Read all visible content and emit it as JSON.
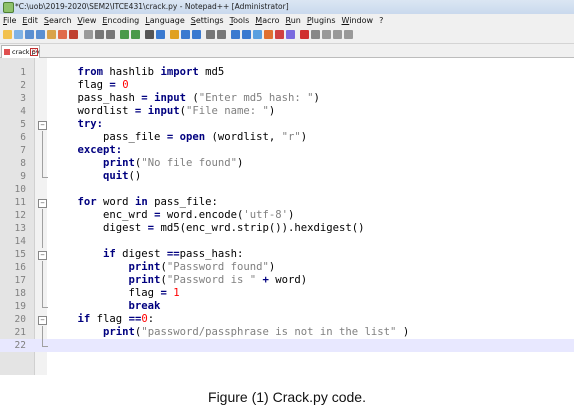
{
  "window": {
    "title": "*C:\\uob\\2019-2020\\SEM2\\ITCE431\\crack.py - Notepad++ [Administrator]"
  },
  "menu": [
    "File",
    "Edit",
    "Search",
    "View",
    "Encoding",
    "Language",
    "Settings",
    "Tools",
    "Macro",
    "Run",
    "Plugins",
    "Window",
    "?"
  ],
  "tab": {
    "label": "crack.py"
  },
  "code_lines": [
    [
      {
        "t": "    "
      },
      {
        "t": "from",
        "c": "kw"
      },
      {
        "t": " hashlib "
      },
      {
        "t": "import",
        "c": "kw"
      },
      {
        "t": " md5"
      }
    ],
    [
      {
        "t": "    flag "
      },
      {
        "t": "=",
        "c": "op"
      },
      {
        "t": " "
      },
      {
        "t": "0",
        "c": "num"
      }
    ],
    [
      {
        "t": "    pass_hash "
      },
      {
        "t": "=",
        "c": "op"
      },
      {
        "t": " "
      },
      {
        "t": "input",
        "c": "kw"
      },
      {
        "t": " ("
      },
      {
        "t": "\"Enter md5 hash: \"",
        "c": "str"
      },
      {
        "t": ")"
      }
    ],
    [
      {
        "t": "    wordlist "
      },
      {
        "t": "=",
        "c": "op"
      },
      {
        "t": " "
      },
      {
        "t": "input",
        "c": "kw"
      },
      {
        "t": "("
      },
      {
        "t": "\"File name: \"",
        "c": "str"
      },
      {
        "t": ")"
      }
    ],
    [
      {
        "t": "    "
      },
      {
        "t": "try:",
        "c": "kw"
      }
    ],
    [
      {
        "t": "        pass_file "
      },
      {
        "t": "=",
        "c": "op"
      },
      {
        "t": " "
      },
      {
        "t": "open",
        "c": "kw"
      },
      {
        "t": " (wordlist, "
      },
      {
        "t": "\"r\"",
        "c": "str"
      },
      {
        "t": ")"
      }
    ],
    [
      {
        "t": "    "
      },
      {
        "t": "except:",
        "c": "kw"
      }
    ],
    [
      {
        "t": "        "
      },
      {
        "t": "print",
        "c": "kw"
      },
      {
        "t": "("
      },
      {
        "t": "\"No file found\"",
        "c": "str"
      },
      {
        "t": ")"
      }
    ],
    [
      {
        "t": "        "
      },
      {
        "t": "quit",
        "c": "kw"
      },
      {
        "t": "()"
      }
    ],
    [],
    [
      {
        "t": "    "
      },
      {
        "t": "for",
        "c": "kw"
      },
      {
        "t": " word "
      },
      {
        "t": "in",
        "c": "kw"
      },
      {
        "t": " pass_file:"
      }
    ],
    [
      {
        "t": "        enc_wrd "
      },
      {
        "t": "=",
        "c": "op"
      },
      {
        "t": " word.encode("
      },
      {
        "t": "'utf-8'",
        "c": "str"
      },
      {
        "t": ")"
      }
    ],
    [
      {
        "t": "        digest "
      },
      {
        "t": "=",
        "c": "op"
      },
      {
        "t": " md5(enc_wrd.strip()).hexdigest()"
      }
    ],
    [],
    [
      {
        "t": "        "
      },
      {
        "t": "if",
        "c": "kw"
      },
      {
        "t": " digest "
      },
      {
        "t": "==",
        "c": "op"
      },
      {
        "t": "pass_hash:"
      }
    ],
    [
      {
        "t": "            "
      },
      {
        "t": "print",
        "c": "kw"
      },
      {
        "t": "("
      },
      {
        "t": "\"Password found\"",
        "c": "str"
      },
      {
        "t": ")"
      }
    ],
    [
      {
        "t": "            "
      },
      {
        "t": "print",
        "c": "kw"
      },
      {
        "t": "("
      },
      {
        "t": "\"Password is \"",
        "c": "str"
      },
      {
        "t": " "
      },
      {
        "t": "+",
        "c": "op"
      },
      {
        "t": " word)"
      }
    ],
    [
      {
        "t": "            flag "
      },
      {
        "t": "=",
        "c": "op"
      },
      {
        "t": " "
      },
      {
        "t": "1",
        "c": "num"
      }
    ],
    [
      {
        "t": "            "
      },
      {
        "t": "break",
        "c": "kw"
      }
    ],
    [
      {
        "t": "    "
      },
      {
        "t": "if",
        "c": "kw"
      },
      {
        "t": " flag "
      },
      {
        "t": "==",
        "c": "op"
      },
      {
        "t": "0",
        "c": "num"
      },
      {
        "t": ":"
      }
    ],
    [
      {
        "t": "        "
      },
      {
        "t": "print",
        "c": "kw"
      },
      {
        "t": "("
      },
      {
        "t": "\"password/passphrase is not in the list\"",
        "c": "str"
      },
      {
        "t": " )"
      }
    ],
    []
  ],
  "fold_markers": [
    "",
    "",
    "",
    "",
    "box",
    "line",
    "line",
    "line",
    "corner",
    "",
    "box",
    "line",
    "line",
    "line",
    "box",
    "line",
    "line",
    "line",
    "corner",
    "box",
    "line",
    "corner"
  ],
  "current_line": 22,
  "caption": "Figure (1) Crack.py code."
}
